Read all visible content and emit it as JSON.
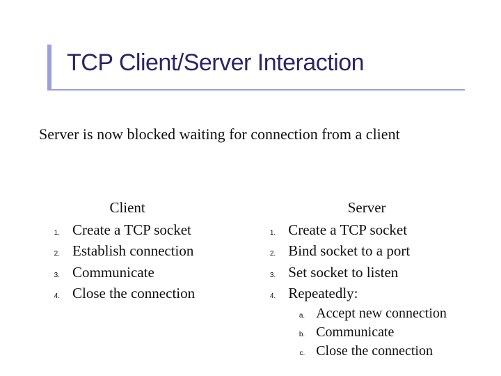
{
  "title": "TCP Client/Server Interaction",
  "subtitle": "Server is now blocked waiting for connection from a client",
  "client": {
    "heading": "Client",
    "items": [
      {
        "n": "1.",
        "t": "Create a TCP socket"
      },
      {
        "n": "2.",
        "t": "Establish connection"
      },
      {
        "n": "3.",
        "t": "Communicate"
      },
      {
        "n": "4.",
        "t": "Close the connection"
      }
    ]
  },
  "server": {
    "heading": "Server",
    "items": [
      {
        "n": "1.",
        "t": "Create a TCP socket"
      },
      {
        "n": "2.",
        "t": "Bind socket to a port"
      },
      {
        "n": "3.",
        "t": "Set socket to listen"
      },
      {
        "n": "4.",
        "t": "Repeatedly:"
      }
    ],
    "subitems": [
      {
        "n": "a.",
        "t": "Accept new connection"
      },
      {
        "n": "b.",
        "t": "Communicate"
      },
      {
        "n": "c.",
        "t": "Close the connection"
      }
    ]
  }
}
